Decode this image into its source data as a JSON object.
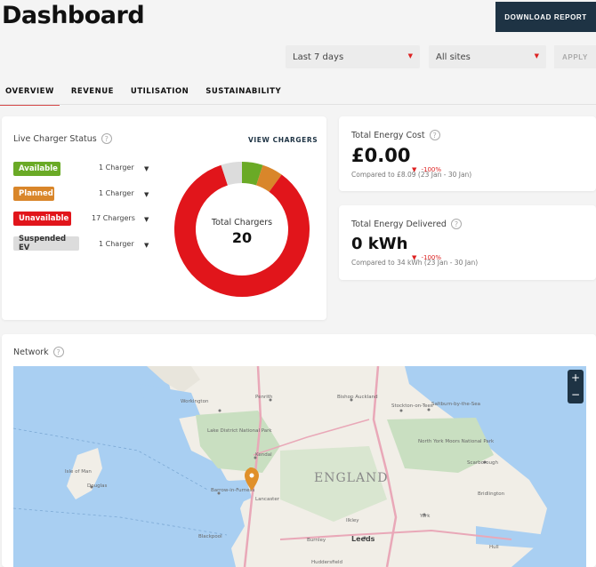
{
  "header": {
    "title": "Dashboard",
    "download_label": "DOWNLOAD REPORT"
  },
  "filters": {
    "period": "Last 7 days",
    "sites": "All sites",
    "apply_label": "APPLY"
  },
  "tabs": [
    {
      "label": "OVERVIEW",
      "active": true
    },
    {
      "label": "REVENUE",
      "active": false
    },
    {
      "label": "UTILISATION",
      "active": false
    },
    {
      "label": "SUSTAINABILITY",
      "active": false
    }
  ],
  "charger_status": {
    "title": "Live Charger Status",
    "view_label": "VIEW CHARGERS",
    "rows": [
      {
        "label": "Available",
        "count": "1 Charger",
        "color": "#6aaa26",
        "value": 1
      },
      {
        "label": "Planned",
        "count": "1 Charger",
        "color": "#d9862a",
        "value": 1
      },
      {
        "label": "Unavailable",
        "count": "17 Chargers",
        "color": "#e1151b",
        "value": 17
      },
      {
        "label": "Suspended EV",
        "count": "1 Charger",
        "color": "#dcdcdc",
        "value": 1
      }
    ],
    "donut_label": "Total Chargers",
    "donut_total": "20"
  },
  "energy_cost": {
    "title": "Total Energy Cost",
    "value": "£0.00",
    "delta": "-100%",
    "compare": "Compared to £8.09 (23 Jan - 30 Jan)"
  },
  "energy_delivered": {
    "title": "Total Energy Delivered",
    "value": "0 kWh",
    "delta": "-100%",
    "compare": "Compared to 34 kWh (23 Jan - 30 Jan)"
  },
  "network": {
    "title": "Network",
    "zoom_in": "+",
    "zoom_out": "−",
    "labels": {
      "england": "ENGLAND",
      "penrith": "Penrith",
      "workington": "Workington",
      "bishop_auckland": "Bishop Auckland",
      "stockton": "Stockton-on-Tees",
      "saltburn": "Saltburn-by-the-Sea",
      "lake_district": "Lake District National Park",
      "north_york_moors": "North York Moors National Park",
      "scarborough": "Scarborough",
      "bridlington": "Bridlington",
      "isle_of_man": "Isle of Man",
      "douglas": "Douglas",
      "kendal": "Kendal",
      "barrow": "Barrow-in-Furness",
      "lancaster": "Lancaster",
      "york": "York",
      "ilkley": "Ilkley",
      "blackpool": "Blackpool",
      "burnley": "Burnley",
      "leeds": "Leeds",
      "hull": "Hull",
      "huddersfield": "Huddersfield"
    }
  }
}
